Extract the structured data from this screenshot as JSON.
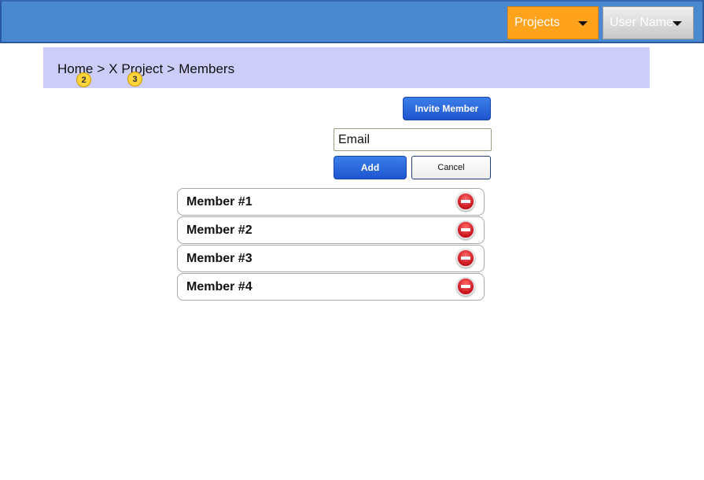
{
  "header": {
    "projects_label": "Projects",
    "user_label": "User Name"
  },
  "breadcrumb": {
    "items": [
      "Home",
      "X Project",
      "Members"
    ],
    "separator": ">"
  },
  "markers": [
    "2",
    "3"
  ],
  "invite": {
    "button_label": "Invite Member",
    "email_placeholder": "Email",
    "add_label": "Add",
    "cancel_label": "Cancel"
  },
  "members": [
    {
      "name": "Member #1"
    },
    {
      "name": "Member #2"
    },
    {
      "name": "Member #3"
    },
    {
      "name": "Member #4"
    }
  ],
  "colors": {
    "topbar": "#4a88d0",
    "projects_dropdown": "#ffa21c",
    "breadcrumb_bg": "#cdcdfa",
    "button_blue": "#2a66dc",
    "remove_red": "#d0141e"
  },
  "icons": {
    "dropdown": "caret-down-icon",
    "remove": "remove-circle-icon"
  }
}
